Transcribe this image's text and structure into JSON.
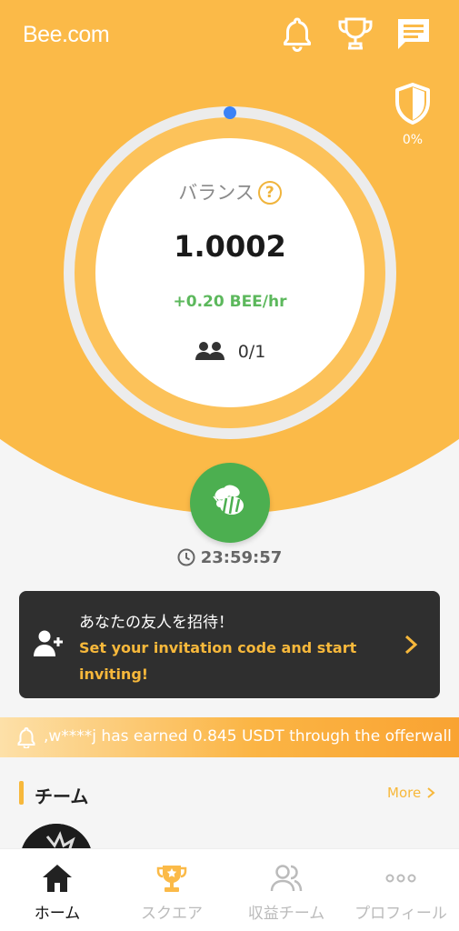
{
  "app": {
    "logo": "Bee.com"
  },
  "header": {
    "shield_percent": "0%"
  },
  "balance": {
    "label": "バランス",
    "help_icon": "?",
    "value": "1.0002",
    "rate": "+0.20 BEE/hr",
    "team_count": "0/1"
  },
  "mining": {
    "timer": "23:59:57"
  },
  "invite": {
    "title": "あなたの友人を招待！",
    "subtitle": "Set your invitation code and start inviting!"
  },
  "ticker": {
    "text": ",w****j has earned 0.845 USDT through the offerwall"
  },
  "team": {
    "title": "チーム",
    "more_label": "More"
  },
  "tabs": [
    {
      "label": "ホーム",
      "icon": "home-icon",
      "active": true
    },
    {
      "label": "スクエア",
      "icon": "trophy-star-icon",
      "active": false
    },
    {
      "label": "収益チーム",
      "icon": "users-icon",
      "active": false
    },
    {
      "label": "プロフィール",
      "icon": "more-dots-icon",
      "active": false
    }
  ],
  "colors": {
    "primary": "#FBBA48",
    "green": "#4CAF50",
    "accent_blue": "#3B82F6",
    "dark_card": "#2F2F2F"
  }
}
